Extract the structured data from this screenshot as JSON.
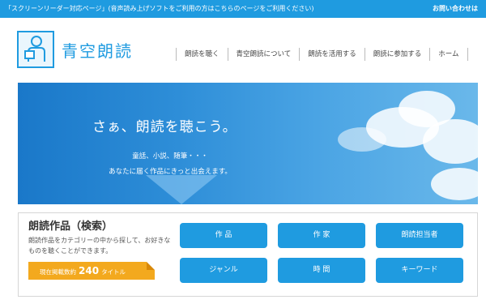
{
  "topbar": {
    "notice": "「スクリーンリーダー対応ページ」(音声読み上げソフトをご利用の方はこちらのページをご利用ください)",
    "contact": "お問い合わせは"
  },
  "logo": {
    "text": "青空朗読"
  },
  "nav": {
    "items": [
      "朗読を聴く",
      "青空朗読について",
      "朗読を活用する",
      "朗読に参加する",
      "ホーム"
    ]
  },
  "hero": {
    "title": "さぁ、朗読を聴こう。",
    "line1": "童話、小説、随筆・・・",
    "line2": "あなたに届く作品にきっと出会えます。"
  },
  "search": {
    "title": "朗読作品（検索）",
    "desc": "朗読作品をカテゴリーの中から探して、お好きなものを聴くことができます。",
    "count_prefix": "現在掲載数約",
    "count_value": "240",
    "count_suffix": "タイトル",
    "buttons": [
      "作 品",
      "作 家",
      "朗読担当者",
      "ジャンル",
      "時 間",
      "キーワード"
    ]
  },
  "colors": {
    "brand_blue": "#1f9be0",
    "badge_orange": "#f3a91e"
  }
}
